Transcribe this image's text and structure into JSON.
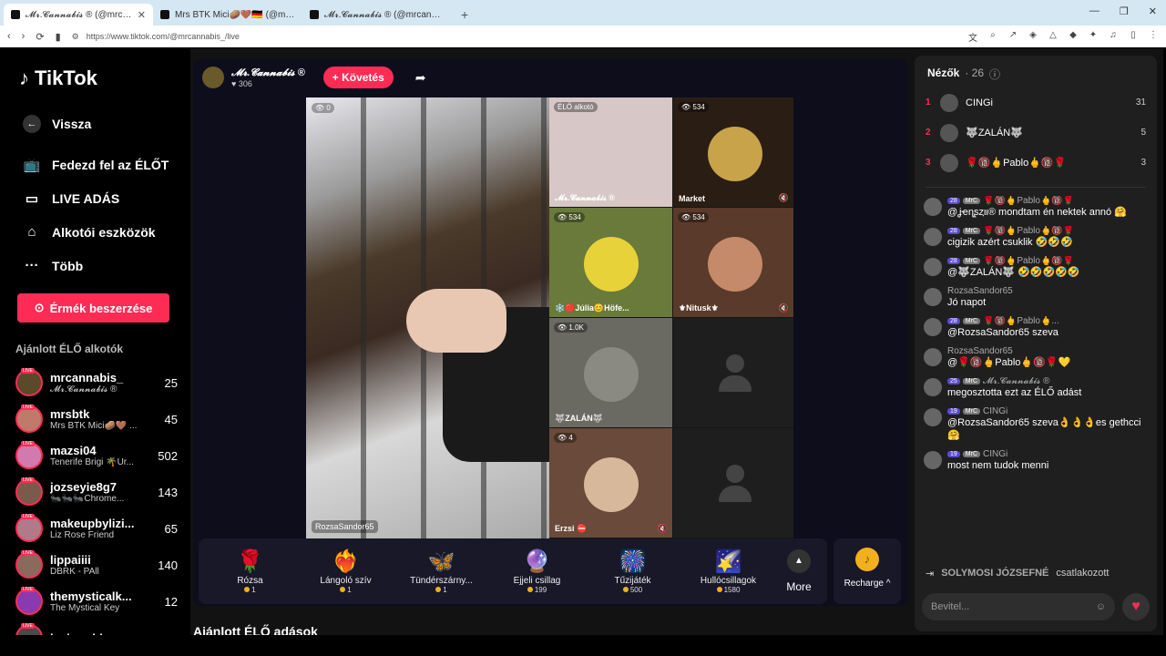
{
  "browser": {
    "tabs": [
      {
        "title": "𝓜𝓻.𝓒𝓪𝓷𝓷𝓪𝓫𝓲𝓼 ® (@mrcan"
      },
      {
        "title": "Mrs BTK Mici🥔🤎🇩🇪 (@mrsbt"
      },
      {
        "title": "𝓜𝓻.𝓒𝓪𝓷𝓷𝓪𝓫𝓲𝓼 ® (@mrcannabis_)"
      }
    ],
    "url": "https://www.tiktok.com/@mrcannabis_/live"
  },
  "sidebar": {
    "logo": "TikTok",
    "back": "Vissza",
    "nav": [
      "Fedezd fel az ÉLŐT",
      "LIVE ADÁS",
      "Alkotói eszközök",
      "Több"
    ],
    "coins_button": "Érmék beszerzése",
    "recommended_title": "Ajánlott ÉLŐ alkotók",
    "creators": [
      {
        "name": "mrcannabis_",
        "sub": "𝓜𝓻.𝓒𝓪𝓷𝓷𝓪𝓫𝓲𝓼 ®",
        "count": "25",
        "color": "#5a4a2a"
      },
      {
        "name": "mrsbtk",
        "sub": "Mrs BTK Mici🥔🤎 ...",
        "count": "45",
        "color": "#c07a6a"
      },
      {
        "name": "mazsi04",
        "sub": "Tenerife Brigi 🌴Úr...",
        "count": "502",
        "color": "#d07ab0"
      },
      {
        "name": "jozseyie8g7",
        "sub": "🐜🐜🐜Chrome...",
        "count": "143",
        "color": "#7a5a4a"
      },
      {
        "name": "makeupbylizi...",
        "sub": "Liz Rose Friend",
        "count": "65",
        "color": "#b07a8a"
      },
      {
        "name": "lippaiiii",
        "sub": "DBRK - PAll",
        "count": "140",
        "color": "#8a6a5a"
      },
      {
        "name": "themysticalk...",
        "sub": "The Mystical Key",
        "count": "12",
        "color": "#8a3ab0"
      },
      {
        "name": "lesiewebber",
        "sub": "",
        "count": "",
        "color": "#4a4a4a"
      }
    ]
  },
  "host": {
    "name": "𝓜𝓻.𝓒𝓪𝓷𝓷𝓪𝓫𝓲𝓼 ®",
    "likes": "306",
    "follow": "+ Követés"
  },
  "stream": {
    "main_viewers": "0",
    "main_label": "RozsaSandor65",
    "cells": [
      {
        "id": "elo",
        "tag": "ÉLŐ alkotó",
        "label": "𝓜𝓻.𝓒𝓪𝓷𝓷𝓪𝓫𝓲𝓼 ®",
        "viewers": "",
        "bg": "#d7c7c7",
        "pic": ""
      },
      {
        "id": "market",
        "tag": "",
        "label": "Market",
        "viewers": "534",
        "bg": "#2a1e14",
        "pic": "#c8a34a"
      },
      {
        "id": "julia",
        "tag": "",
        "label": "❄️🔴Júlia😊Höfe...",
        "viewers": "534",
        "bg": "#6a7a3a",
        "pic": "#e8d23a"
      },
      {
        "id": "nitusk",
        "tag": "",
        "label": "⚜Nitusk⚜",
        "viewers": "534",
        "bg": "#5a3a2a",
        "pic": "#c48a6a"
      },
      {
        "id": "zalan",
        "tag": "",
        "label": "🐺ZALÁN🐺",
        "viewers": "1.0K",
        "bg": "#6a6a62",
        "pic": "#8a8a82"
      },
      {
        "id": "empty1",
        "tag": "",
        "label": "",
        "viewers": "",
        "bg": "#1e1e1e",
        "pic": ""
      },
      {
        "id": "erzsi",
        "tag": "",
        "label": "Erzsi ⛔",
        "viewers": "4",
        "bg": "#6a4a3a",
        "pic": "#d8b89a"
      },
      {
        "id": "empty2",
        "tag": "",
        "label": "",
        "viewers": "",
        "bg": "#1e1e1e",
        "pic": ""
      }
    ]
  },
  "gifts": [
    {
      "name": "Rózsa",
      "price": "1",
      "icon": "🌹"
    },
    {
      "name": "Lángoló szív",
      "price": "1",
      "icon": "❤️‍🔥"
    },
    {
      "name": "Tündérszárny...",
      "price": "1",
      "icon": "🦋"
    },
    {
      "name": "Éjjeli csillag",
      "price": "199",
      "icon": "🔮"
    },
    {
      "name": "Tűzijáték",
      "price": "500",
      "icon": "🎆"
    },
    {
      "name": "Hullócsillagok",
      "price": "1580",
      "icon": "🌠"
    }
  ],
  "more_label": "More",
  "recharge_label": "Recharge ^",
  "recommended_title": "Ajánlott ÉLŐ adások",
  "chat": {
    "viewers_title": "Nézők",
    "viewers_count": "· 26",
    "top_viewers": [
      {
        "rank": "1",
        "name": "CINGi",
        "score": "31"
      },
      {
        "rank": "2",
        "name": "🐺ZALÁN🐺",
        "score": "5"
      },
      {
        "rank": "3",
        "name": "🌹🔞🖕Pablo🖕🔞🌹",
        "score": "3"
      }
    ],
    "messages": [
      {
        "user": "🌹🔞🖕Pablo🖕🔞🌹",
        "badge": "28",
        "text": "@ʝҽɳʂȥιι® mondtam én nektek annó 🤗"
      },
      {
        "user": "🌹🔞🖕Pablo🖕🔞🌹",
        "badge": "28",
        "text": "cigizik azért csuklik 🤣🤣🤣"
      },
      {
        "user": "🌹🔞🖕Pablo🖕🔞🌹",
        "badge": "28",
        "text": "@🐺ZALÁN🐺 🤣🤣🤣🤣🤣"
      },
      {
        "user": "RozsaSandor65",
        "badge": "",
        "text": "Jó napot"
      },
      {
        "user": "🌹🔞🖕Pablo🖕...",
        "badge": "28",
        "text": "@RozsaSandor65 szeva"
      },
      {
        "user": "RozsaSandor65",
        "badge": "",
        "text": "@🌹🔞🖕Pablo🖕🔞🌹💛"
      },
      {
        "user": "𝓜𝓻.𝓒𝓪𝓷𝓷𝓪𝓫𝓲𝓼 ®",
        "badge": "25",
        "text": "megosztotta ezt az ÉLŐ adást"
      },
      {
        "user": "CINGi",
        "badge": "19",
        "text": "@RozsaSandor65 szeva👌👌👌es gethcci🤗"
      },
      {
        "user": "CINGi",
        "badge": "19",
        "text": "most nem tudok menni"
      }
    ],
    "joined_user": "SOLYMOSI JÓZSEFNÉ",
    "joined_text": "csatlakozott",
    "input_placeholder": "Bevitel..."
  }
}
